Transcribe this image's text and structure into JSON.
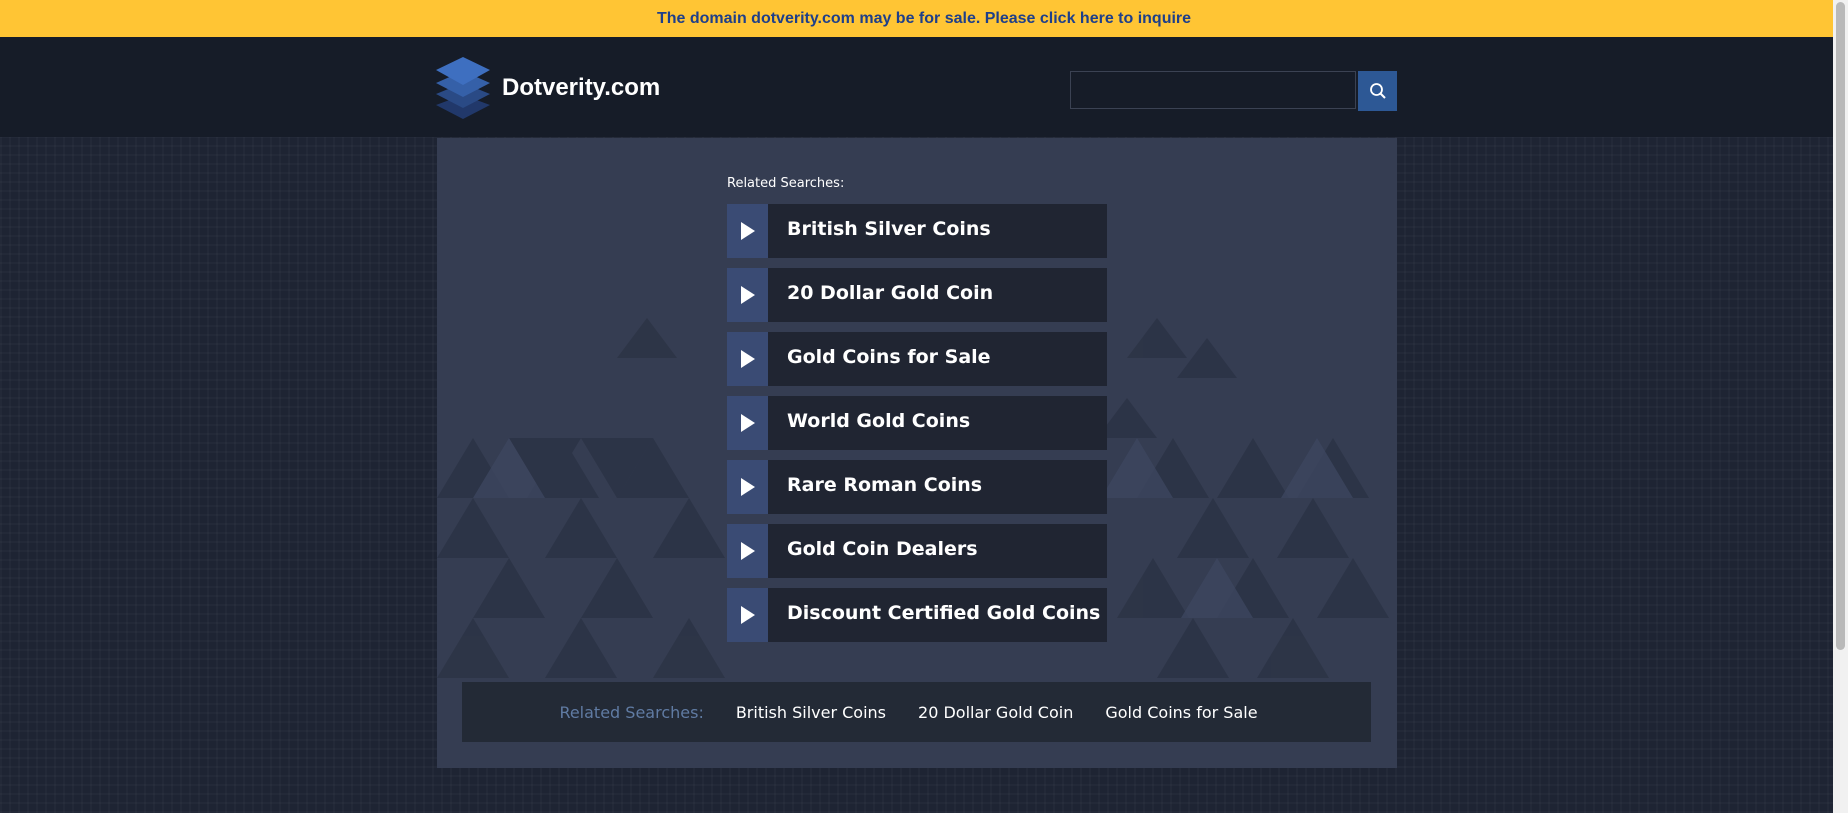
{
  "banner": {
    "text": "The domain dotverity.com may be for sale. Please click here to inquire"
  },
  "header": {
    "logo_icon": "stacked-layers-icon",
    "site_name": "Dotverity.com"
  },
  "search": {
    "value": "",
    "button_icon": "search-icon"
  },
  "main": {
    "heading": "Related Searches:",
    "arrow_icon": "play-arrow-icon",
    "links": [
      "British Silver Coins",
      "20 Dollar Gold Coin",
      "Gold Coins for Sale",
      "World Gold Coins",
      "Rare Roman Coins",
      "Gold Coin Dealers",
      "Discount Certified Gold Coins"
    ]
  },
  "footer": {
    "label": "Related Searches:",
    "links": [
      "British Silver Coins",
      "20 Dollar Gold Coin",
      "Gold Coins for Sale"
    ]
  },
  "colors": {
    "banner_bg": "#ffc534",
    "banner_text": "#1e3f8a",
    "header_bg": "#161c28",
    "panel_bg": "#353d52",
    "link_bg": "#202532",
    "arrow_bg": "#3a4b74",
    "search_button": "#2d5895",
    "footer_label": "#607ba3"
  }
}
